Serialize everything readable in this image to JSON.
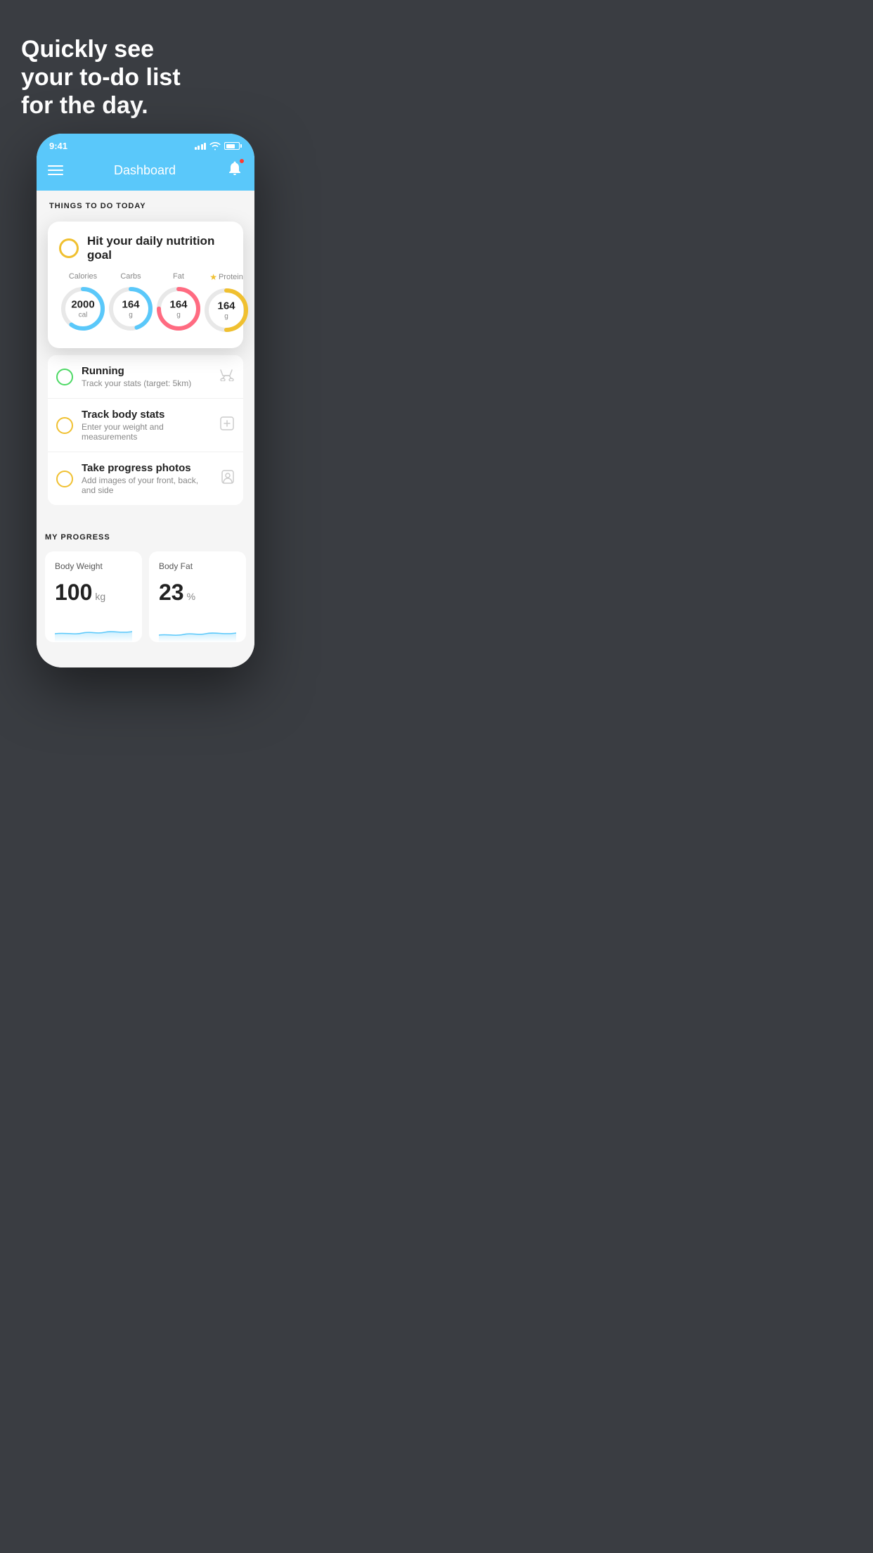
{
  "background": {
    "headline_line1": "Quickly see",
    "headline_line2": "your to-do list",
    "headline_line3": "for the day."
  },
  "status_bar": {
    "time": "9:41"
  },
  "app_header": {
    "title": "Dashboard"
  },
  "things_to_do": {
    "section_title": "THINGS TO DO TODAY",
    "nutrition_card": {
      "title": "Hit your daily nutrition goal",
      "items": [
        {
          "label": "Calories",
          "value": "2000",
          "unit": "cal",
          "color": "#5ac8fa",
          "progress": 0.6,
          "star": false
        },
        {
          "label": "Carbs",
          "value": "164",
          "unit": "g",
          "color": "#5ac8fa",
          "progress": 0.45,
          "star": false
        },
        {
          "label": "Fat",
          "value": "164",
          "unit": "g",
          "color": "#ff6b81",
          "progress": 0.75,
          "star": false
        },
        {
          "label": "Protein",
          "value": "164",
          "unit": "g",
          "color": "#f0c030",
          "progress": 0.5,
          "star": true
        }
      ]
    },
    "todo_items": [
      {
        "id": "running",
        "title": "Running",
        "subtitle": "Track your stats (target: 5km)",
        "circle_color": "green",
        "icon": "👟"
      },
      {
        "id": "body-stats",
        "title": "Track body stats",
        "subtitle": "Enter your weight and measurements",
        "circle_color": "yellow",
        "icon": "⚖️"
      },
      {
        "id": "progress-photos",
        "title": "Take progress photos",
        "subtitle": "Add images of your front, back, and side",
        "circle_color": "yellow",
        "icon": "👤"
      }
    ]
  },
  "my_progress": {
    "section_title": "MY PROGRESS",
    "cards": [
      {
        "title": "Body Weight",
        "value": "100",
        "unit": "kg"
      },
      {
        "title": "Body Fat",
        "value": "23",
        "unit": "%"
      }
    ]
  }
}
